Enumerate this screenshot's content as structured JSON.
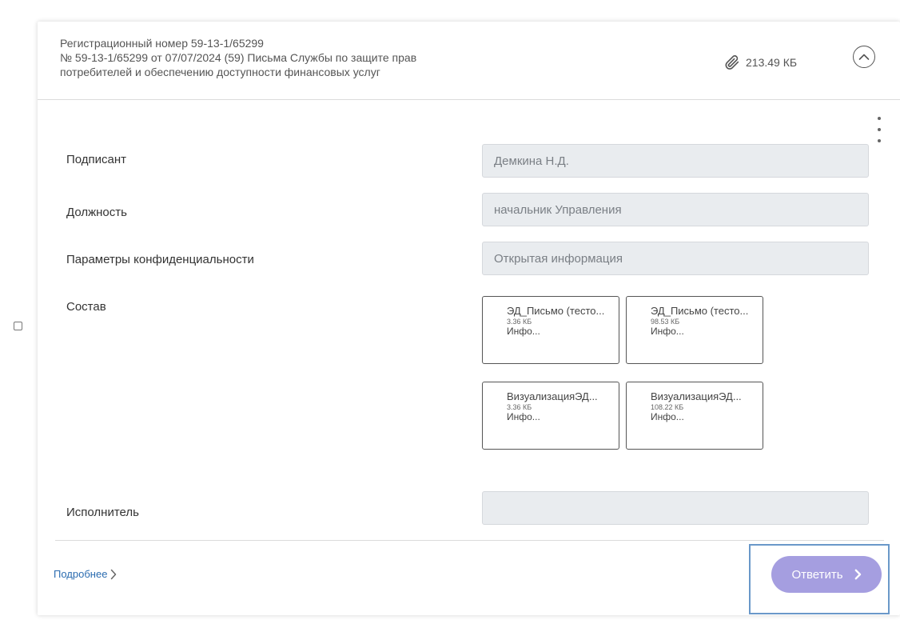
{
  "header": {
    "line1": "Регистрационный номер 59-13-1/65299",
    "line2": "№ 59-13-1/65299 от 07/07/2024 (59) Письма Службы по защите прав",
    "line3": "потребителей и обеспечению доступности финансовых услуг",
    "attachment_size": "213.49 КБ",
    "icons": {
      "attachment": "paperclip-icon",
      "collapse": "chevron-up-circle-icon",
      "more": "kebab-menu-icon"
    }
  },
  "fields": {
    "signer": {
      "label": "Подписант",
      "value": "Демкина Н.Д."
    },
    "position": {
      "label": "Должность",
      "value": "начальник Управления"
    },
    "confidentiality": {
      "label": "Параметры конфиденциальности",
      "value": "Открытая информация"
    },
    "composition": {
      "label": "Состав"
    },
    "executor": {
      "label": "Исполнитель",
      "value": ""
    }
  },
  "files": [
    {
      "name": "ЭД_Письмо (тесто...",
      "size": "3.36 КБ",
      "class": "Инфо..."
    },
    {
      "name": "ЭД_Письмо (тесто...",
      "size": "98.53 КБ",
      "class": "Инфо..."
    },
    {
      "name": "ВизуализацияЭД...",
      "size": "3.36 КБ",
      "class": "Инфо..."
    },
    {
      "name": "ВизуализацияЭД...",
      "size": "108.22 КБ",
      "class": "Инфо..."
    }
  ],
  "footer": {
    "more_link": "Подробнее",
    "reply_button": "Ответить"
  },
  "colors": {
    "reply_button": "#a59ee0",
    "highlight_frame": "#6a98c9",
    "link": "#2b6cb0",
    "field_bg": "#e9ecef"
  }
}
